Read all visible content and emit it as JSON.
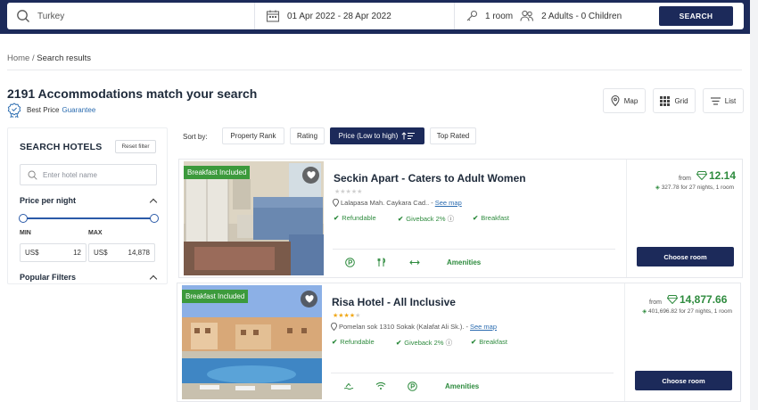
{
  "search": {
    "destination": "Turkey",
    "dates": "01 Apr 2022 - 28 Apr 2022",
    "rooms": "1 room",
    "guests": "2 Adults - 0 Children",
    "button": "SEARCH"
  },
  "breadcrumb": {
    "home": "Home",
    "sep": " / ",
    "current": "Search results"
  },
  "results": {
    "title": "2191 Accommodations match your search",
    "best_price": "Best Price",
    "guarantee": "Guarantee"
  },
  "views": {
    "map": "Map",
    "grid": "Grid",
    "list": "List"
  },
  "sidebar": {
    "title": "SEARCH HOTELS",
    "reset": "Reset filter",
    "hotel_placeholder": "Enter hotel name",
    "price_per_night": "Price per night",
    "min_label": "MIN",
    "max_label": "MAX",
    "currency": "US$",
    "min_value": "12",
    "max_value": "14,878",
    "popular_filters": "Popular Filters"
  },
  "sort": {
    "label": "Sort by:",
    "options": [
      "Property Rank",
      "Rating",
      "Price (Low to high)",
      "Top Rated"
    ],
    "active": "Price (Low to high)"
  },
  "hotels": [
    {
      "badge": "Breakfast Included",
      "name": "Seckin Apart - Caters to Adult Women",
      "stars": 0,
      "address": "Lalapasa Mah. Caykara Cad..",
      "see_map": "See map",
      "features": [
        "Refundable",
        "Giveback 2%",
        "Breakfast"
      ],
      "amenities_label": "Amenities",
      "from": "from",
      "price": "12.14",
      "total": "327.78 for 27 nights, 1 room",
      "button": "Choose room"
    },
    {
      "badge": "Breakfast Included",
      "name": "Risa Hotel - All Inclusive",
      "stars": 4,
      "address": "Pomelan sok 1310 Sokak (Kalafat Ali Sk.).",
      "see_map": "See map",
      "features": [
        "Refundable",
        "Giveback 2%",
        "Breakfast"
      ],
      "amenities_label": "Amenities",
      "from": "from",
      "price": "14,877.66",
      "total": "401,696.82 for 27 nights, 1 room",
      "button": "Choose room"
    }
  ],
  "colors": {
    "navy": "#1c2a5a",
    "green": "#2e8b3e",
    "star": "#f0a818",
    "link": "#2b6cb0"
  }
}
